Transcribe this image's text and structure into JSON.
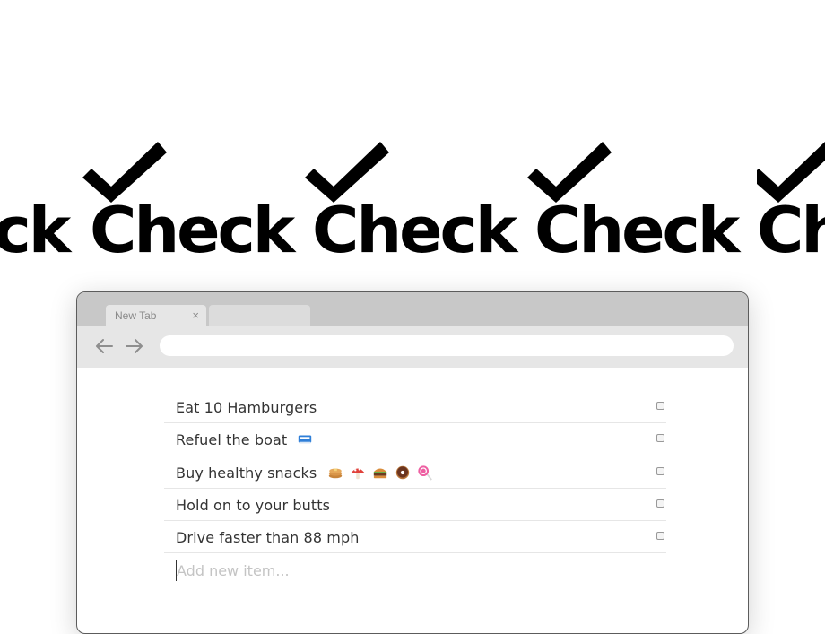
{
  "hero": {
    "word": "Check",
    "icon": "checkmark-icon",
    "repeats": [
      "Check",
      "Check",
      "Check",
      "Check",
      "Check"
    ]
  },
  "browser": {
    "tabs": [
      {
        "label": "New Tab",
        "close": "×"
      },
      {
        "label": ""
      }
    ],
    "url": "",
    "icons": {
      "back": "arrow-left-icon",
      "forward": "arrow-right-icon"
    }
  },
  "todo": {
    "items": [
      {
        "text": "Eat 10 Hamburgers",
        "emoji": []
      },
      {
        "text": "Refuel the boat",
        "emoji": [
          "ship-icon"
        ]
      },
      {
        "text": "Buy healthy snacks",
        "emoji": [
          "pancakes-icon",
          "mushroom-icon",
          "hamburger-icon",
          "doughnut-icon",
          "lollipop-icon"
        ]
      },
      {
        "text": "Hold on to your butts",
        "emoji": []
      },
      {
        "text": "Drive faster than 88 mph",
        "emoji": []
      }
    ],
    "placeholder": "Add new item..."
  },
  "colors": {
    "text": "#333333",
    "tabstrip": "#c8c8c8",
    "toolbar": "#e6e6e6",
    "divider": "#e6e6e6"
  }
}
